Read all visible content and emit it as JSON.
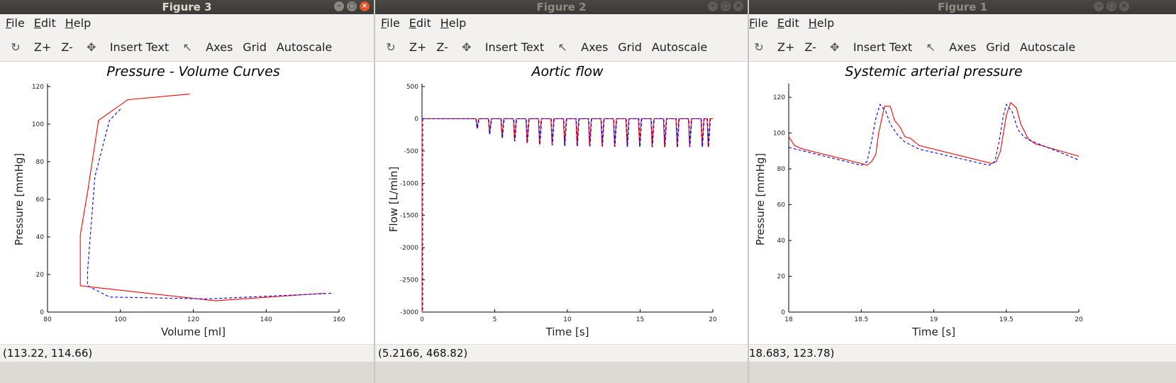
{
  "windows": [
    {
      "id": "fig3",
      "title": "Figure 3",
      "active": true,
      "menu": [
        "File",
        "Edit",
        "Help"
      ],
      "toolbar": [
        "Z+",
        "Z-",
        "Insert Text",
        "Axes",
        "Grid",
        "Autoscale"
      ],
      "status": "(113.22, 114.66)",
      "chart_data": {
        "type": "line",
        "title": "Pressure - Volume Curves",
        "xlabel": "Volume [ml]",
        "ylabel": "Pressure [mmHg]",
        "xlim": [
          80,
          160
        ],
        "ylim": [
          0,
          120
        ],
        "xticks": [
          80,
          100,
          120,
          140,
          160
        ],
        "yticks": [
          0,
          20,
          40,
          60,
          80,
          100,
          120
        ],
        "series": [
          {
            "color": "#ff0000",
            "dash": false,
            "points": [
              [
                119,
                116
              ],
              [
                102,
                113
              ],
              [
                94,
                102
              ],
              [
                91,
                64
              ],
              [
                89,
                41
              ],
              [
                89,
                14
              ],
              [
                126,
                6
              ],
              [
                156,
                10
              ]
            ]
          },
          {
            "color": "#0000ff",
            "dash": true,
            "points": [
              [
                100,
                108
              ],
              [
                97,
                102
              ],
              [
                93,
                72
              ],
              [
                91,
                22
              ],
              [
                91,
                14
              ],
              [
                97,
                8
              ],
              [
                124,
                7
              ],
              [
                158,
                10
              ]
            ]
          }
        ]
      }
    },
    {
      "id": "fig2",
      "title": "Figure 2",
      "active": false,
      "menu": [
        "File",
        "Edit",
        "Help"
      ],
      "toolbar": [
        "Z+",
        "Z-",
        "Insert Text",
        "Axes",
        "Grid",
        "Autoscale"
      ],
      "status": "(5.2166, 468.82)",
      "chart_data": {
        "type": "line",
        "title": "Aortic flow",
        "xlabel": "Time [s]",
        "ylabel": "Flow [L/min]",
        "xlim": [
          0,
          20
        ],
        "ylim": [
          -3000,
          500
        ],
        "xticks": [
          0,
          5,
          10,
          15,
          20
        ],
        "yticks": [
          -3000,
          -2500,
          -2000,
          -1500,
          -1000,
          -500,
          0,
          500
        ],
        "pulse_times": [
          3.7,
          4.56,
          5.42,
          6.28,
          7.14,
          8.0,
          8.86,
          9.72,
          10.58,
          11.44,
          12.3,
          13.16,
          14.02,
          14.88,
          15.74,
          16.6,
          17.46,
          18.32,
          19.18,
          19.6
        ],
        "pulse_minima": [
          -150,
          -240,
          -300,
          -350,
          -380,
          -400,
          -410,
          -420,
          -425,
          -430,
          -430,
          -435,
          -435,
          -435,
          -440,
          -440,
          -440,
          -440,
          -440,
          -440
        ],
        "series": [
          {
            "color": "#ff0000",
            "dash": false
          },
          {
            "color": "#0000ff",
            "dash": true
          }
        ]
      }
    },
    {
      "id": "fig1",
      "title": "Figure 1",
      "active": false,
      "menu": [
        "File",
        "Edit",
        "Help"
      ],
      "toolbar": [
        "Z+",
        "Z-",
        "Insert Text",
        "Axes",
        "Grid",
        "Autoscale"
      ],
      "status": "18.683, 123.78)",
      "chart_data": {
        "type": "line",
        "title": "Systemic arterial pressure",
        "xlabel": "Time [s]",
        "ylabel": "Pressure [mmHg]",
        "xlim": [
          18,
          20
        ],
        "ylim": [
          0,
          126
        ],
        "xticks": [
          18,
          18.5,
          19,
          19.5,
          20
        ],
        "yticks": [
          0,
          20,
          40,
          60,
          80,
          100,
          120
        ],
        "series": [
          {
            "color": "#ff0000",
            "dash": false,
            "points": [
              [
                18,
                98
              ],
              [
                18.04,
                93
              ],
              [
                18.1,
                91
              ],
              [
                18.5,
                83
              ],
              [
                18.54,
                82
              ],
              [
                18.57,
                84
              ],
              [
                18.6,
                88
              ],
              [
                18.62,
                100
              ],
              [
                18.66,
                115
              ],
              [
                18.7,
                115
              ],
              [
                18.73,
                107
              ],
              [
                18.77,
                103
              ],
              [
                18.8,
                98
              ],
              [
                18.84,
                97
              ],
              [
                18.9,
                93
              ],
              [
                19.4,
                83
              ],
              [
                19.43,
                84
              ],
              [
                19.46,
                90
              ],
              [
                19.5,
                110
              ],
              [
                19.53,
                117
              ],
              [
                19.57,
                114
              ],
              [
                19.6,
                105
              ],
              [
                19.65,
                97
              ],
              [
                19.7,
                94
              ],
              [
                20,
                87
              ]
            ]
          },
          {
            "color": "#0000ff",
            "dash": true,
            "points": [
              [
                18,
                92
              ],
              [
                18.5,
                82
              ],
              [
                18.54,
                84
              ],
              [
                18.57,
                95
              ],
              [
                18.6,
                108
              ],
              [
                18.63,
                116
              ],
              [
                18.67,
                112
              ],
              [
                18.7,
                105
              ],
              [
                18.75,
                99
              ],
              [
                18.8,
                95
              ],
              [
                18.85,
                93
              ],
              [
                18.9,
                91
              ],
              [
                19.38,
                82
              ],
              [
                19.42,
                84
              ],
              [
                19.45,
                95
              ],
              [
                19.48,
                110
              ],
              [
                19.5,
                116
              ],
              [
                19.54,
                112
              ],
              [
                19.58,
                102
              ],
              [
                19.62,
                98
              ],
              [
                19.66,
                96
              ],
              [
                20,
                85
              ]
            ]
          }
        ]
      }
    }
  ]
}
